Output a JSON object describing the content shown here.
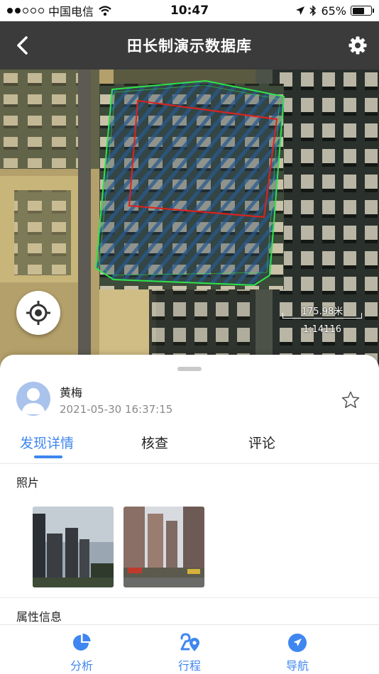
{
  "status_bar": {
    "carrier": "中国电信",
    "time": "10:47",
    "battery": "65%",
    "battery_level": 0.65
  },
  "nav": {
    "title": "田长制演示数据库",
    "back_icon": "chevron-left-icon",
    "settings_icon": "gear-icon"
  },
  "map": {
    "scale_distance": "175.98米",
    "scale_ratio": "1:14116",
    "locate_icon": "locate-crosshair-icon"
  },
  "record": {
    "user_name": "黄梅",
    "timestamp": "2021-05-30 16:37:15",
    "favorite_icon": "star-outline-icon"
  },
  "tabs": [
    {
      "label": "发现详情",
      "active": true
    },
    {
      "label": "核查",
      "active": false
    },
    {
      "label": "评论",
      "active": false
    }
  ],
  "sections": {
    "photos": "照片",
    "attributes": "属性信息"
  },
  "bottom_tabs": [
    {
      "label": "分析",
      "icon": "pie-chart-icon"
    },
    {
      "label": "行程",
      "icon": "route-icon"
    },
    {
      "label": "导航",
      "icon": "navigation-arrow-icon"
    }
  ],
  "colors": {
    "accent": "#3f86f0",
    "nav_bg": "#3b3b3b",
    "parcel_outline": "#2ee44a",
    "finding_outline": "#e0221c"
  }
}
